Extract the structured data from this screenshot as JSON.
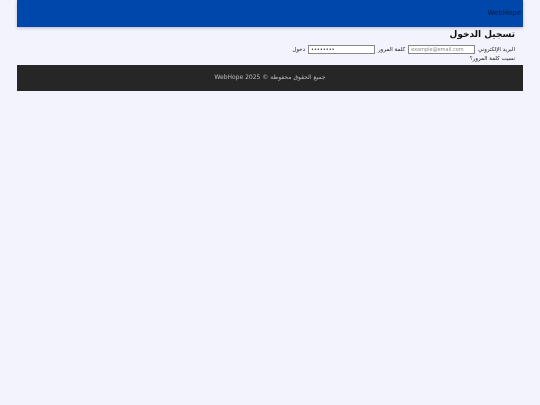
{
  "header": {
    "brand": "WebHope"
  },
  "login": {
    "title": "تسجيل الدخول",
    "email_label": "البريد الإلكتروني",
    "email_placeholder": "example@email.com",
    "password_label": "كلمة المرور",
    "password_value": "••••••••",
    "submit_label": "دخول",
    "forgot_label": "نسيت كلمة المرور؟"
  },
  "footer": {
    "text": "جميع الحقوق محفوظة © 2025 WebHope"
  },
  "colors": {
    "header_bg": "#0047ab",
    "page_bg": "#f2f3fd",
    "footer_bg": "#262626"
  }
}
